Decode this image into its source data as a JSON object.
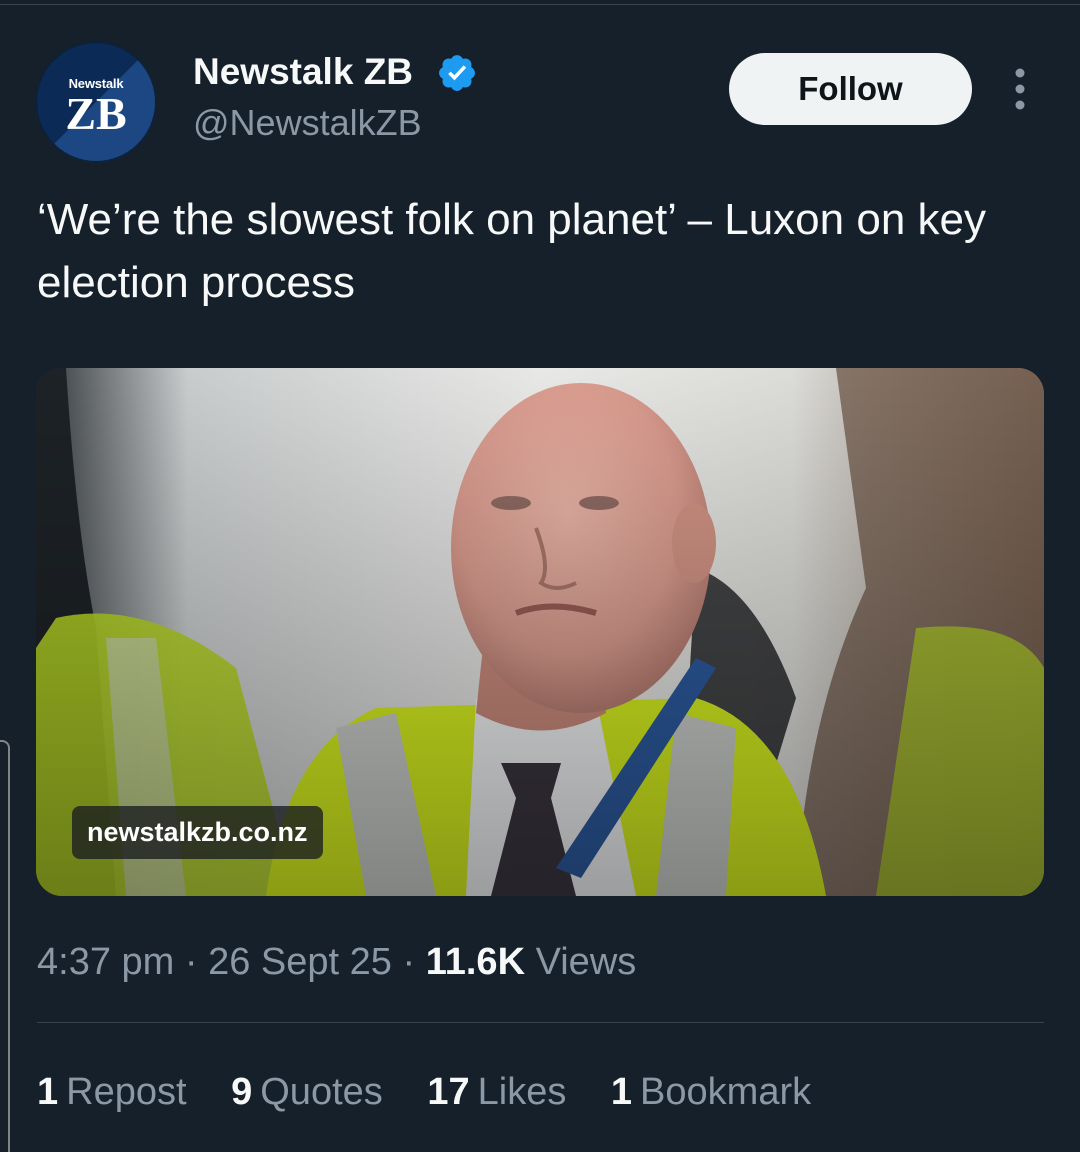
{
  "account": {
    "avatar_small": "Newstalk",
    "avatar_big": "ZB",
    "display_name": "Newstalk ZB",
    "handle": "@NewstalkZB",
    "verified": true
  },
  "actions": {
    "follow_label": "Follow",
    "more_icon": "more-vertical-icon"
  },
  "post": {
    "text": "‘We’re the slowest folk on planet’ – Luxon on key election process"
  },
  "card": {
    "domain": "newstalkzb.co.nz",
    "image_icon": "news-photo"
  },
  "meta": {
    "time": "4:37 pm",
    "date": "26 Sept 25",
    "views_count": "11.6K",
    "views_label": "Views",
    "separator": "·"
  },
  "stats": [
    {
      "count": "1",
      "label": "Repost"
    },
    {
      "count": "9",
      "label": "Quotes"
    },
    {
      "count": "17",
      "label": "Likes"
    },
    {
      "count": "1",
      "label": "Bookmark"
    }
  ],
  "colors": {
    "background": "#15202b",
    "primary_text": "#f7f9f9",
    "secondary_text": "#8b98a5",
    "verified_blue": "#1d9bf0",
    "follow_bg": "#eff3f4",
    "divider": "#38444d"
  }
}
